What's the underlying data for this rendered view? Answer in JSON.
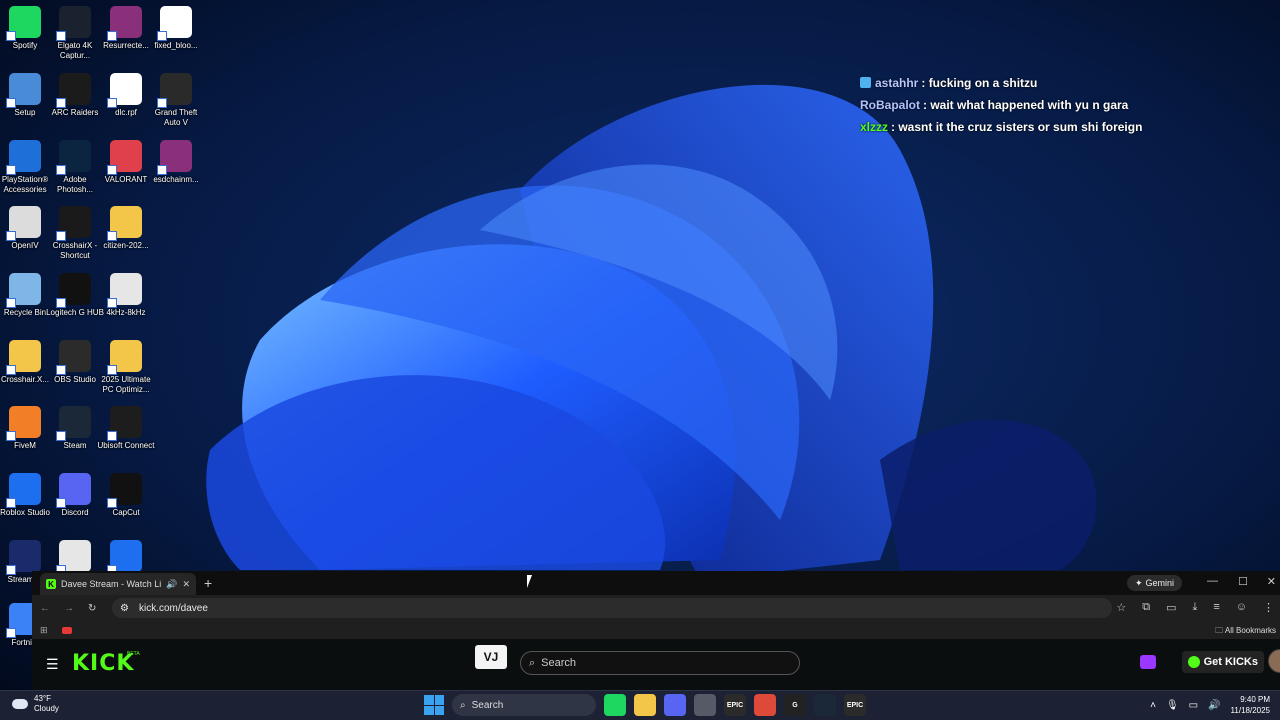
{
  "desktop": {
    "icons": [
      {
        "label": "Spotify",
        "icon": "spotify-icon",
        "color": "#1ed760"
      },
      {
        "label": "Elgato 4K Captur...",
        "icon": "elgato-4k-icon",
        "color": "#1a2230"
      },
      {
        "label": "Resurrecte...",
        "icon": "winrar-archive-icon",
        "color": "#8a2f7a"
      },
      {
        "label": "fixed_bloo...",
        "icon": "file-icon",
        "color": "#ffffff"
      },
      {
        "label": "Setup",
        "icon": "setup-icon",
        "color": "#4a8bd8"
      },
      {
        "label": "ARC Raiders",
        "icon": "arc-raiders-icon",
        "color": "#1b1b1b"
      },
      {
        "label": "dlc.rpf",
        "icon": "file-icon",
        "color": "#ffffff"
      },
      {
        "label": "Grand Theft Auto V",
        "icon": "gta-v-icon",
        "color": "#2a2a2a"
      },
      {
        "label": "PlayStation® Accessories",
        "icon": "playstation-icon",
        "color": "#1f6fd8"
      },
      {
        "label": "Adobe Photosh...",
        "icon": "photoshop-icon",
        "color": "#0b2440"
      },
      {
        "label": "VALORANT",
        "icon": "valorant-icon",
        "color": "#e0404b"
      },
      {
        "label": "esdchainm...",
        "icon": "winrar-archive-icon",
        "color": "#8a2f7a"
      },
      {
        "label": "OpenIV",
        "icon": "openiv-icon",
        "color": "#dcdcdc"
      },
      {
        "label": "CrosshairX - Shortcut",
        "icon": "crosshairx-icon",
        "color": "#1a1a1a"
      },
      {
        "label": "citizen-202...",
        "icon": "folder-icon",
        "color": "#f3c64a"
      },
      {
        "label": "Recycle Bin",
        "icon": "recycle-bin-icon",
        "color": "#7fb6e8"
      },
      {
        "label": "Logitech G HUB",
        "icon": "logitech-ghub-icon",
        "color": "#111111"
      },
      {
        "label": "4kHz-8kHz",
        "icon": "settings-file-icon",
        "color": "#e6e6e6"
      },
      {
        "label": "Crosshair.X...",
        "icon": "folder-icon",
        "color": "#f3c64a"
      },
      {
        "label": "OBS Studio",
        "icon": "obs-icon",
        "color": "#2b2b2b"
      },
      {
        "label": "2025 Ultimate PC Optimiz...",
        "icon": "folder-icon",
        "color": "#f3c64a"
      },
      {
        "label": "FiveM",
        "icon": "fivem-icon",
        "color": "#f27e28"
      },
      {
        "label": "Steam",
        "icon": "steam-icon",
        "color": "#1b2838"
      },
      {
        "label": "Ubisoft Connect",
        "icon": "ubisoft-icon",
        "color": "#1d1d1d"
      },
      {
        "label": "Roblox Studio",
        "icon": "roblox-studio-icon",
        "color": "#1e6ff0"
      },
      {
        "label": "Discord",
        "icon": "discord-icon",
        "color": "#5865f2"
      },
      {
        "label": "CapCut",
        "icon": "capcut-icon",
        "color": "#111111"
      },
      {
        "label": "Stream ...",
        "icon": "stream-deck-icon",
        "color": "#1a2a6a"
      },
      {
        "label": "",
        "icon": "settings-file-icon",
        "color": "#e6e6e6"
      },
      {
        "label": "",
        "icon": "roblox-icon",
        "color": "#1e6ff0"
      },
      {
        "label": "Fortni...",
        "icon": "fortnite-icon",
        "color": "#3b82f6"
      }
    ]
  },
  "chat": {
    "messages": [
      {
        "user": "astahhr",
        "text": ": fucking on a shitzu",
        "color": "#b6c7ff",
        "badge": true
      },
      {
        "user": "RoBapalot",
        "text": ": wait what happened with yu n gara",
        "color": "#b2c2ff",
        "badge": false
      },
      {
        "user": "xlzzz",
        "text": ": wasnt it the cruz sisters or sum shi foreign",
        "color": "#53fc18",
        "badge": false
      }
    ]
  },
  "browser": {
    "tab_title": "Davee Stream - Watch Live",
    "tab_favicon": "K",
    "gemini_label": "Gemini",
    "url": "kick.com/davee",
    "bookmarks_label": "All Bookmarks"
  },
  "kick": {
    "logo": "KICK",
    "beta": "BETA",
    "vj_label": "VJ",
    "search_placeholder": "Search",
    "get_kicks_label": "Get KICKs"
  },
  "taskbar": {
    "weather_temp": "43°F",
    "weather_desc": "Cloudy",
    "search_label": "Search",
    "time": "9:40 PM",
    "date": "11/18/2025",
    "apps": [
      {
        "name": "spotify-taskbar-icon",
        "color": "#1ed760",
        "glyph": ""
      },
      {
        "name": "file-explorer-taskbar-icon",
        "color": "#f3c64a",
        "glyph": ""
      },
      {
        "name": "discord-taskbar-icon",
        "color": "#5865f2",
        "glyph": ""
      },
      {
        "name": "task-app-taskbar-icon",
        "color": "#555a66",
        "glyph": ""
      },
      {
        "name": "epic-games-taskbar-icon",
        "color": "#2b2b2b",
        "glyph": "EPIC"
      },
      {
        "name": "chrome-taskbar-icon",
        "color": "#dd4a3a",
        "glyph": ""
      },
      {
        "name": "logitech-taskbar-icon",
        "color": "#222222",
        "glyph": "G"
      },
      {
        "name": "steam-taskbar-icon",
        "color": "#1b2838",
        "glyph": ""
      },
      {
        "name": "epic-games-2-taskbar-icon",
        "color": "#2b2b2b",
        "glyph": "EPIC"
      }
    ]
  }
}
